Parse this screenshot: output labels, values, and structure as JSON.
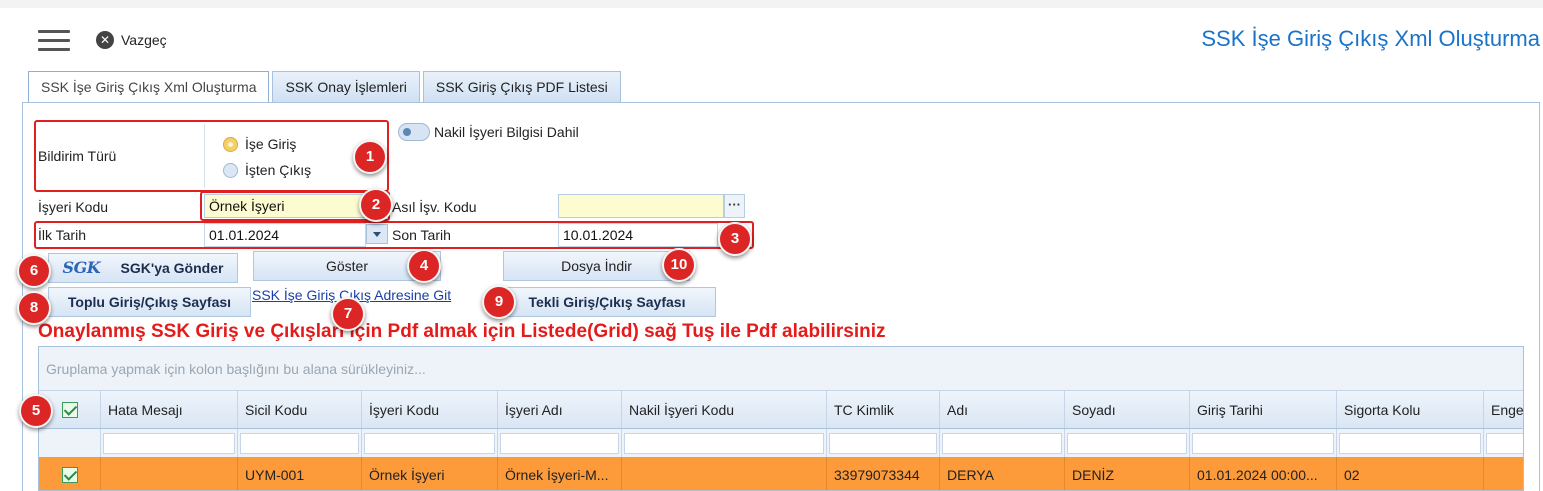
{
  "topbar": {
    "cancel_label": "Vazgeç",
    "title": "SSK İşe Giriş Çıkış Xml Oluşturma"
  },
  "tabs": [
    {
      "label": "SSK İşe Giriş Çıkış Xml Oluşturma",
      "active": true
    },
    {
      "label": "SSK Onay İşlemleri",
      "active": false
    },
    {
      "label": "SSK Giriş Çıkış PDF Listesi",
      "active": false
    }
  ],
  "form": {
    "bildirim_turu_label": "Bildirim Türü",
    "radio_ise_giris": "İşe Giriş",
    "radio_isten_cikis": "İşten Çıkış",
    "selected_radio": "İşe Giriş",
    "nakil_toggle_label": "Nakil İşyeri Bilgisi Dahil",
    "isyeri_kodu_label": "İşyeri Kodu",
    "isyeri_kodu_value": "Örnek İşyeri",
    "asil_isv_kodu_label": "Asıl İşv. Kodu",
    "asil_isv_kodu_value": "",
    "ellipsis": "···",
    "ilk_tarih_label": "İlk Tarih",
    "ilk_tarih_value": "01.01.2024",
    "son_tarih_label": "Son Tarih",
    "son_tarih_value": "10.01.2024"
  },
  "buttons": {
    "sgk_logo": "SGK",
    "sgk_gonder": "SGK'ya Gönder",
    "goster": "Göster",
    "dosya_indir": "Dosya İndir",
    "toplu": "Toplu Giriş/Çıkış Sayfası",
    "tekli": "Tekli Giriş/Çıkış Sayfası",
    "ssk_link": "SSK İşe Giriş Çıkış Adresine Git"
  },
  "notice": "Onaylanmış SSK Giriş ve Çıkışları için Pdf almak için Listede(Grid) sağ Tuş ile Pdf alabilirsiniz",
  "badges": [
    "1",
    "2",
    "3",
    "4",
    "5",
    "6",
    "7",
    "8",
    "9",
    "10"
  ],
  "grid": {
    "group_hint": "Gruplama yapmak için kolon başlığını bu alana sürükleyiniz...",
    "columns": [
      "Hata Mesajı",
      "Sicil Kodu",
      "İşyeri Kodu",
      "İşyeri Adı",
      "Nakil İşyeri Kodu",
      "TC Kimlik",
      "Adı",
      "Soyadı",
      "Giriş Tarihi",
      "Sigorta Kolu",
      "Enge"
    ],
    "rows": [
      {
        "checked": true,
        "cells": [
          "",
          "UYM-001",
          "Örnek İşyeri",
          "Örnek İşyeri-M...",
          "",
          "33979073344",
          "DERYA",
          "DENİZ",
          "01.01.2024 00:00...",
          "02",
          ""
        ]
      }
    ]
  },
  "colors": {
    "accent_blue": "#1a73c8",
    "highlight_red": "#e02020",
    "row_orange": "#fd9b3a",
    "input_yellow": "#fdfbd0"
  }
}
